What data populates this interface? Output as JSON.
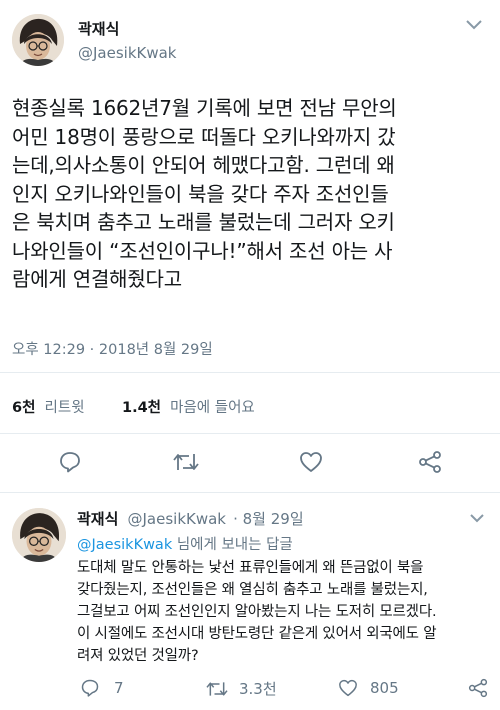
{
  "tweet": {
    "author_name": "곽재식",
    "author_handle": "@JaesikKwak",
    "lines": [
      "현종실록 1662년7월 기록에 보면 전남 무안의",
      "어민 18명이 풍랑으로 떠돌다 오키나와까지 갔",
      "는데,의사소통이 안되어 헤맸다고함. 그런데 왜",
      "인지 오키나와인들이 북을 갖다 주자 조선인들",
      "은 북치며 춤추고 노래를 불렀는데 그러자 오키",
      "나와인들이 “조선인이구나!”해서 조선 아는 사",
      "람에게 연결해줬다고"
    ],
    "timestamp": "오후 12:29 · 2018년 8월 29일",
    "retweets_count": "6천",
    "retweets_label": "리트윗",
    "likes_count": "1.4천",
    "likes_label": "마음에 들어요"
  },
  "icons": {
    "reply": "reply-icon",
    "retweet": "retweet-icon",
    "like": "heart-icon",
    "share": "share-icon"
  },
  "reply": {
    "author_name": "곽재식",
    "author_handle": "@JaesikKwak",
    "date": "· 8월 29일",
    "to_handle": "@JaesikKwak",
    "to_suffix": " 님에게 보내는 답글",
    "lines": [
      "도대체 말도 안통하는 낯선 표류인들에게 왜 뜬금없이 북을",
      "갖다줬는지, 조선인들은 왜 열심히 춤추고 노래를 불렀는지,",
      "그걸보고 어찌 조선인인지 알아봤는지 나는 도저히 모르겠다.",
      "이 시절에도 조선시대 방탄도령단 같은게 있어서 외국에도 알",
      "려져 있었던 것일까?"
    ],
    "reply_count": "7",
    "retweet_count": "3.3천",
    "like_count": "805"
  },
  "colors": {
    "text": "#14171a",
    "secondary": "#657786",
    "link": "#1b95e0",
    "divider": "#e6ecf0"
  }
}
